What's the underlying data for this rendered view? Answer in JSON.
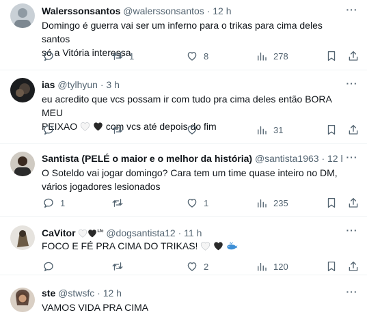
{
  "tweets": [
    {
      "name": "Walerssonsantos",
      "handle": "@walerssonsantos",
      "time": "12 h",
      "separator": "·",
      "lines": [
        "Domingo é guerra vai ser um inferno para o trikas para cima deles santos",
        "só a Vitória interessa"
      ],
      "replies": "",
      "retweets": "1",
      "likes": "8",
      "views": "278"
    },
    {
      "name": "ias",
      "handle": "@tylhyun",
      "time": "3 h",
      "separator": "·",
      "lines": [
        "eu acredito que vcs possam ir com tudo pra cima deles então BORA MEU",
        "PEIXAO",
        "com vcs até depois do fim"
      ],
      "replies": "",
      "retweets": "",
      "likes": "",
      "views": "31"
    },
    {
      "name": "Santista (PELÉ o maior e o melhor da história)",
      "handle": "@santista1963",
      "time": "12 h",
      "separator": "·",
      "lines": [
        "O Soteldo vai jogar domingo? Cara tem um time quase inteiro no DM,",
        "vários jogadores lesionados"
      ],
      "replies": "1",
      "retweets": "",
      "likes": "1",
      "views": "235"
    },
    {
      "name": "CaVitor",
      "name_badge": "Lfc",
      "handle": "@dogsantista12",
      "time": "11 h",
      "separator": "·",
      "lines": [
        "FOCO E FÉ PRA CIMA DO TRIKAS!"
      ],
      "replies": "",
      "retweets": "",
      "likes": "2",
      "views": "120"
    },
    {
      "name": "ste",
      "handle": "@stwsfc",
      "time": "12 h",
      "separator": "·",
      "lines": [
        "VAMOS VIDA PRA CIMA"
      ]
    }
  ],
  "icons": {
    "reply": "reply-icon",
    "retweet": "retweet-icon",
    "like": "heart-icon",
    "views": "analytics-icon",
    "bookmark": "bookmark-icon",
    "share": "share-icon",
    "more": "more-icon"
  },
  "colors": {
    "text": "#0f1419",
    "secondary": "#536471",
    "divider": "#eff3f4"
  }
}
